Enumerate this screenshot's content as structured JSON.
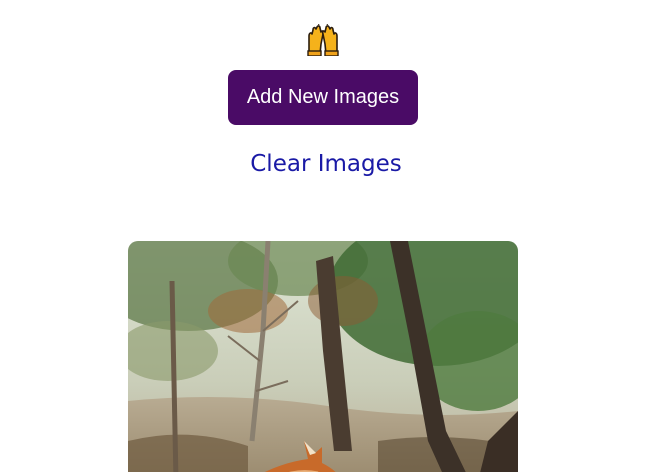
{
  "emoji": {
    "icon": "raising-hands-icon",
    "color": "#f5b21b"
  },
  "actions": {
    "add_label": "Add New Images",
    "clear_label": "Clear Images"
  },
  "colors": {
    "button_bg": "#4a0b66",
    "button_text": "#ffffff",
    "link": "#1a1aa6"
  },
  "gallery": {
    "images": [
      {
        "subject": "fox-in-pine-forest-photo"
      }
    ]
  }
}
